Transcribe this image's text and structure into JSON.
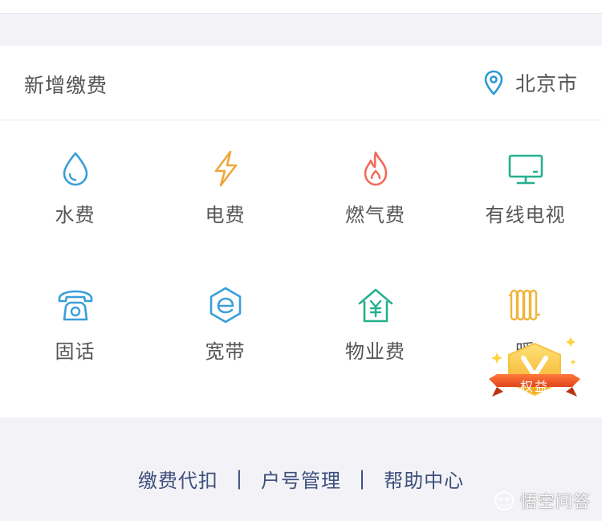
{
  "header": {
    "title": "新增缴费",
    "location_icon": "location-pin-icon",
    "city": "北京市"
  },
  "services": [
    {
      "label": "水费",
      "icon": "water-drop-icon",
      "color": "#3a9fd9"
    },
    {
      "label": "电费",
      "icon": "lightning-icon",
      "color": "#f0a63a"
    },
    {
      "label": "燃气费",
      "icon": "flame-icon",
      "color": "#f06b5a"
    },
    {
      "label": "有线电视",
      "icon": "tv-icon",
      "color": "#26b08e"
    },
    {
      "label": "固话",
      "icon": "telephone-icon",
      "color": "#3a9fd9"
    },
    {
      "label": "宽带",
      "icon": "broadband-e-icon",
      "color": "#3a9fd9"
    },
    {
      "label": "物业费",
      "icon": "house-yuan-icon",
      "color": "#26b08e"
    },
    {
      "label": "暖",
      "icon": "radiator-icon",
      "color": "#f0b43a"
    }
  ],
  "badge": {
    "label": "权益",
    "icon": "v-badge-icon"
  },
  "footer": {
    "links": [
      "缴费代扣",
      "户号管理",
      "帮助中心"
    ],
    "separator": "|"
  },
  "watermark": {
    "text": "悟空问答"
  }
}
